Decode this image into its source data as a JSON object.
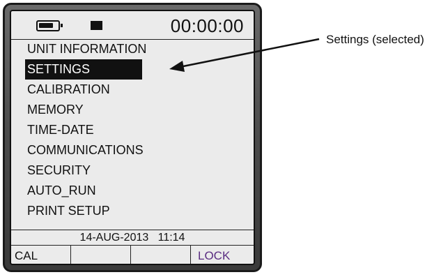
{
  "device": {
    "status_bar": {
      "battery_icon": "battery-icon",
      "record_icon": "record-icon",
      "timer": "00:00:00"
    },
    "menu": {
      "items": [
        {
          "label": "UNIT INFORMATION",
          "selected": false
        },
        {
          "label": "SETTINGS",
          "selected": true
        },
        {
          "label": "CALIBRATION",
          "selected": false
        },
        {
          "label": "MEMORY",
          "selected": false
        },
        {
          "label": "TIME-DATE",
          "selected": false
        },
        {
          "label": "COMMUNICATIONS",
          "selected": false
        },
        {
          "label": "SECURITY",
          "selected": false
        },
        {
          "label": "AUTO_RUN",
          "selected": false
        },
        {
          "label": "PRINT SETUP",
          "selected": false
        }
      ]
    },
    "date_time": "14-AUG-2013   11:14",
    "softkeys": [
      {
        "label": "CAL"
      },
      {
        "label": ""
      },
      {
        "label": ""
      },
      {
        "label": "LOCK"
      }
    ]
  },
  "annotation": {
    "text": "Settings (selected)"
  },
  "colors": {
    "screen_bg": "#ebebeb",
    "selection_bg": "#111111",
    "lock_accent": "#5a2d82",
    "bezel": "#4b4b4b"
  }
}
